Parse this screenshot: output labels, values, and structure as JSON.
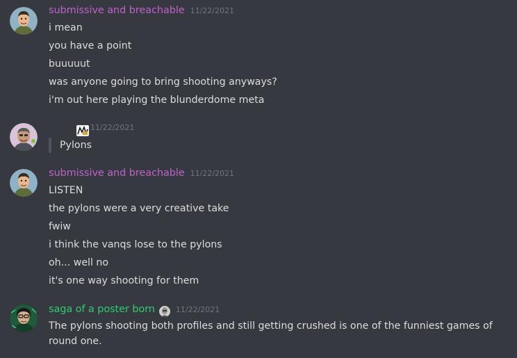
{
  "messages": [
    {
      "author": "submissive and breachable",
      "author_color": "#c061cb",
      "timestamp": "11/22/2021",
      "lines": [
        "i mean",
        "you have a point",
        "buuuuut",
        "was anyone going to bring shooting anyways?",
        "i'm out here playing the blunderdome meta"
      ]
    },
    {
      "author": "",
      "timestamp": "11/22/2021",
      "quote": "Pylons"
    },
    {
      "author": "submissive and breachable",
      "author_color": "#c061cb",
      "timestamp": "11/22/2021",
      "lines": [
        "LISTEN",
        "the pylons were a very creative take",
        "fwiw",
        "i think the vanqs lose to the pylons",
        "oh... well no",
        "it's one way shooting for them"
      ]
    },
    {
      "author": "saga of a poster born",
      "author_color": "#2ecc71",
      "timestamp": "11/22/2021",
      "lines": [
        "The pylons shooting both profiles and still getting crushed is one of the funniest games of round one."
      ]
    }
  ]
}
